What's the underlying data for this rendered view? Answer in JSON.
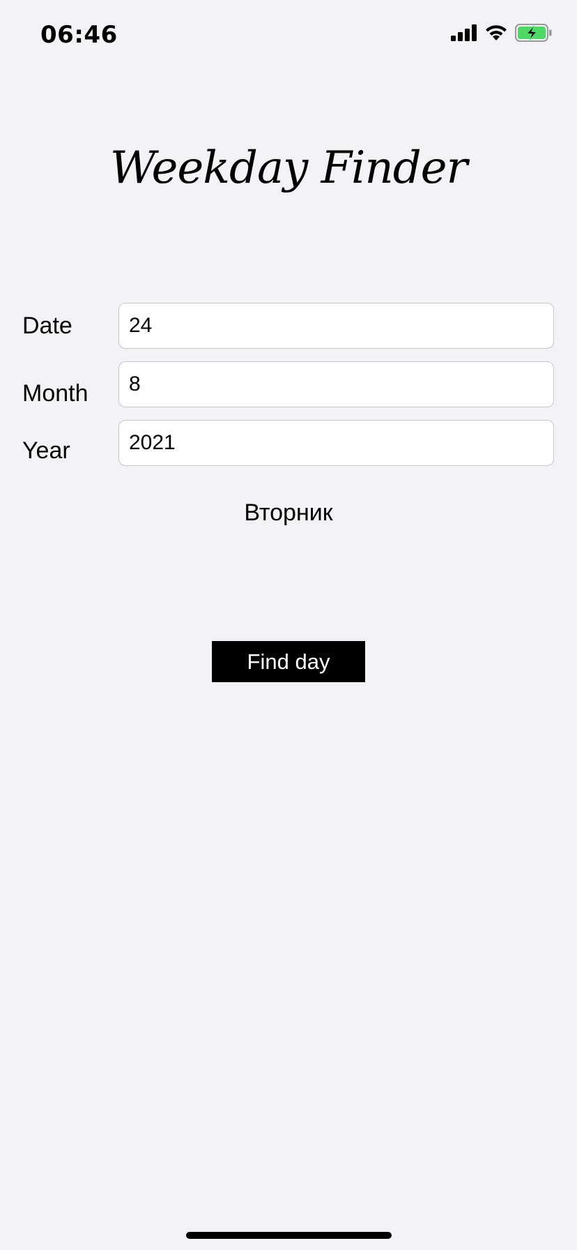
{
  "status_bar": {
    "time": "06:46",
    "icons": [
      "signal-icon",
      "wifi-icon",
      "battery-charging-icon"
    ],
    "battery_color": "#4cd964"
  },
  "app": {
    "title": "Weekday Finder"
  },
  "form": {
    "date": {
      "label": "Date",
      "value": "24"
    },
    "month": {
      "label": "Month",
      "value": "8"
    },
    "year": {
      "label": "Year",
      "value": "2021"
    }
  },
  "result_text": "Вторник",
  "button": {
    "label": "Find day"
  }
}
